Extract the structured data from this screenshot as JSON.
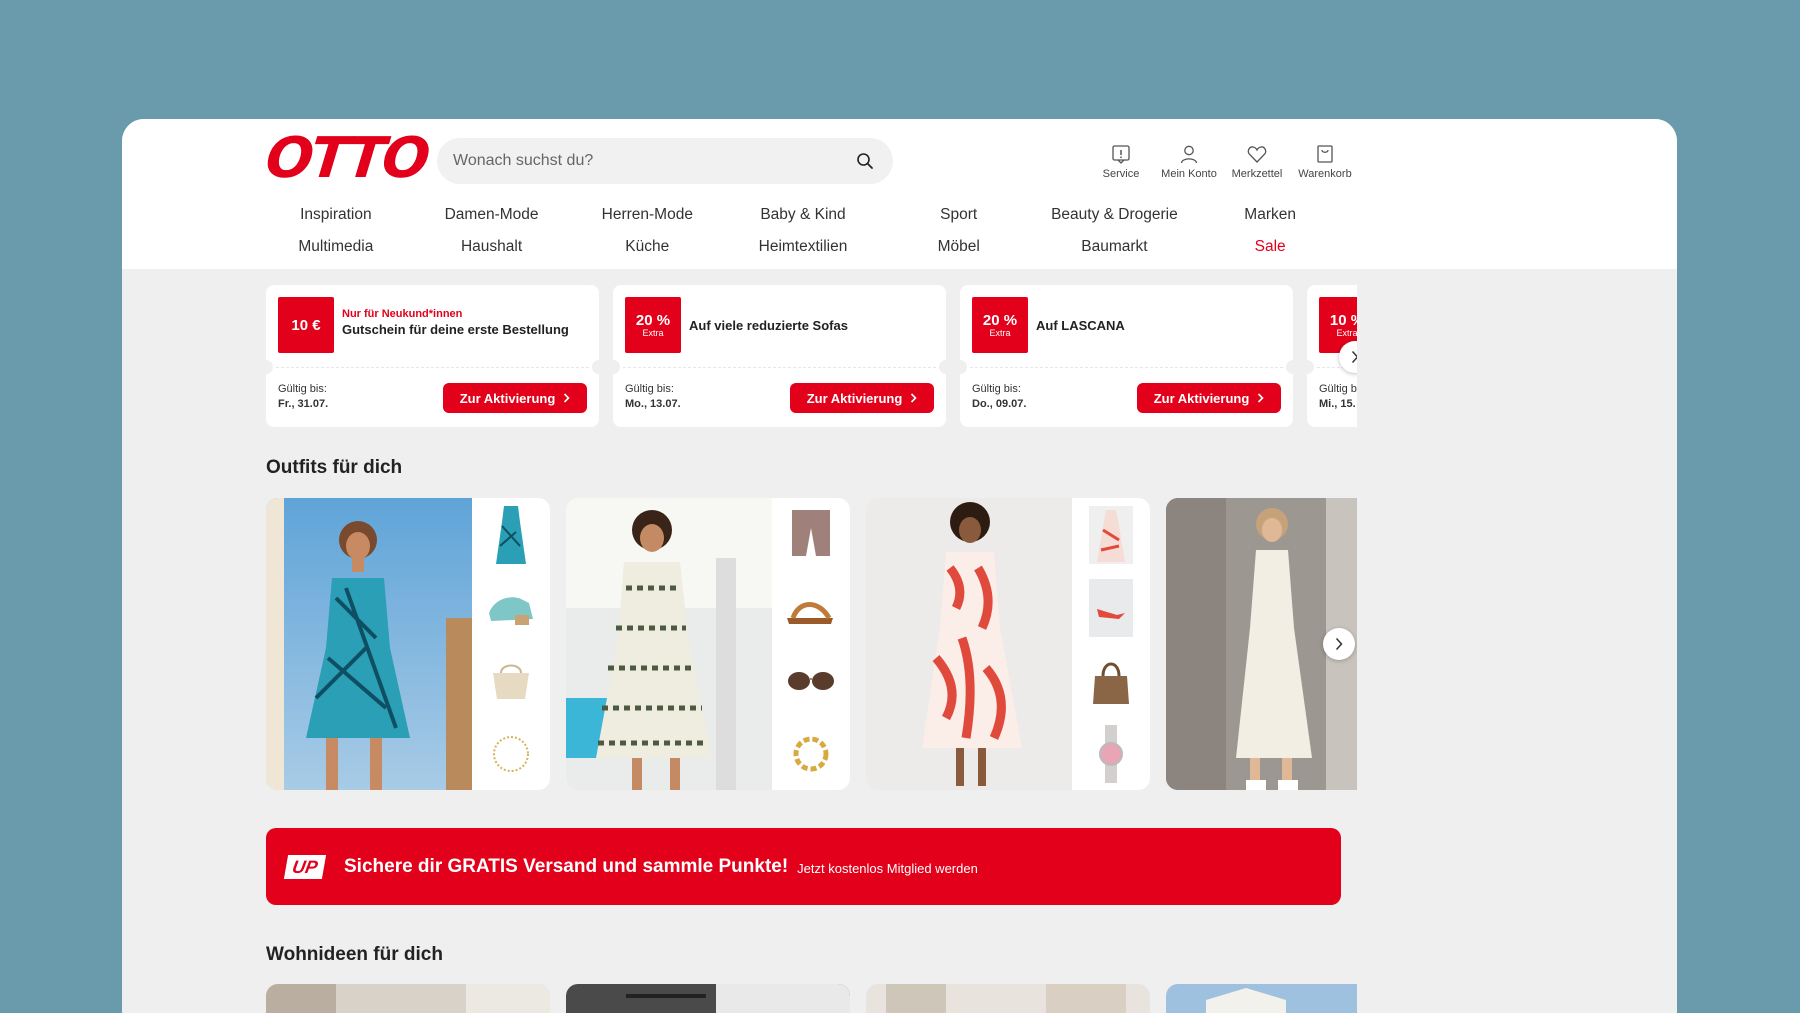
{
  "header": {
    "logo": "OTTO",
    "search": {
      "placeholder": "Wonach suchst du?"
    },
    "icons": [
      {
        "label": "Service",
        "icon": "info-icon"
      },
      {
        "label": "Mein Konto",
        "icon": "user-icon"
      },
      {
        "label": "Merkzettel",
        "icon": "heart-icon"
      },
      {
        "label": "Warenkorb",
        "icon": "cart-icon"
      }
    ],
    "nav": [
      "Inspiration",
      "Damen-Mode",
      "Herren-Mode",
      "Baby & Kind",
      "Sport",
      "Beauty & Drogerie",
      "Marken",
      "Multimedia",
      "Haushalt",
      "Küche",
      "Heimtextilien",
      "Möbel",
      "Baumarkt",
      "Sale"
    ]
  },
  "coupons": [
    {
      "badge": "10 €",
      "badge_sub": "",
      "kicker": "Nur für Neukund*innen",
      "title": "Gutschein für deine erste Bestellung",
      "valid_label": "Gültig bis:",
      "valid_date": "Fr., 31.07.",
      "button": "Zur Aktivierung"
    },
    {
      "badge": "20 %",
      "badge_sub": "Extra",
      "kicker": "",
      "title": "Auf viele reduzierte Sofas",
      "valid_label": "Gültig bis:",
      "valid_date": "Mo., 13.07.",
      "button": "Zur Aktivierung"
    },
    {
      "badge": "20 %",
      "badge_sub": "Extra",
      "kicker": "",
      "title": "Auf LASCANA",
      "valid_label": "Gültig bis:",
      "valid_date": "Do., 09.07.",
      "button": "Zur Aktivierung"
    },
    {
      "badge": "10 %",
      "badge_sub": "Extra",
      "kicker": "",
      "title": "",
      "valid_label": "Gültig bis:",
      "valid_date": "Mi., 15.",
      "button": ""
    }
  ],
  "outfits": {
    "title": "Outfits für dich"
  },
  "up_banner": {
    "logo": "UP",
    "text": "Sichere dir GRATIS Versand und sammle Punkte!",
    "sub": "Jetzt kostenlos Mitglied werden"
  },
  "wohnideen": {
    "title": "Wohnideen für dich"
  },
  "colors": {
    "brand_red": "#e2001a",
    "background": "#6a9bad",
    "page_bg": "#efefef"
  }
}
